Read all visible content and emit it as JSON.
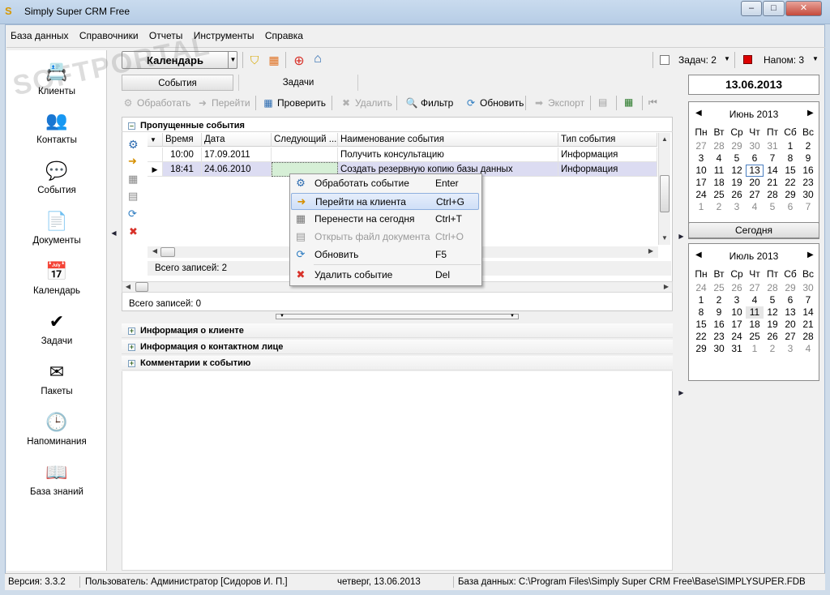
{
  "window": {
    "title": "Simply Super CRM Free",
    "app_icon_glyph": "S",
    "min": "–",
    "max": "□",
    "close": "✕"
  },
  "menu": [
    "База данных",
    "Справочники",
    "Отчеты",
    "Инструменты",
    "Справка"
  ],
  "toolbar": {
    "module_combo": "Календарь",
    "tasks_label": "Задач: 2",
    "reminders_label": "Напом: 3"
  },
  "watermark": "SOFTPORTAL",
  "nav": [
    {
      "label": "Клиенты",
      "icon": "clients-icon",
      "glyph": "📇"
    },
    {
      "label": "Контакты",
      "icon": "contacts-icon",
      "glyph": "👥"
    },
    {
      "label": "События",
      "icon": "events-icon",
      "glyph": "💬"
    },
    {
      "label": "Документы",
      "icon": "documents-icon",
      "glyph": "📄"
    },
    {
      "label": "Календарь",
      "icon": "calendar-icon",
      "glyph": "📅"
    },
    {
      "label": "Задачи",
      "icon": "tasks-icon",
      "glyph": "✔"
    },
    {
      "label": "Пакеты",
      "icon": "packages-icon",
      "glyph": "✉"
    },
    {
      "label": "Напоминания",
      "icon": "reminders-icon",
      "glyph": "🕒"
    },
    {
      "label": "База знаний",
      "icon": "knowledge-base-icon",
      "glyph": "📖"
    }
  ],
  "tabs": [
    "События",
    "Задачи"
  ],
  "actions": [
    {
      "label": "Обработать",
      "disabled": true,
      "glyph": "⚙"
    },
    {
      "label": "Перейти",
      "disabled": true,
      "glyph": "➜"
    },
    {
      "label": "Проверить",
      "disabled": false,
      "glyph": "▦"
    },
    {
      "label": "Удалить",
      "disabled": true,
      "glyph": "✖"
    },
    {
      "label": "Фильтр",
      "disabled": false,
      "glyph": "🔍"
    },
    {
      "label": "Обновить",
      "disabled": false,
      "glyph": "⟳"
    },
    {
      "label": "Экспорт",
      "disabled": true,
      "glyph": "➡"
    }
  ],
  "grid": {
    "group_title": "Пропущенные события",
    "columns": [
      "Время",
      "Дата",
      "Следующий ...",
      "Наименование события",
      "Тип события"
    ],
    "rows": [
      [
        "10:00",
        "17.09.2011",
        "",
        "Получить консультацию",
        "Информация"
      ],
      [
        "18:41",
        "24.06.2010",
        "",
        "Создать резервную копию базы данных",
        "Информация"
      ]
    ],
    "inner_total": "Всего записей: 2",
    "outer_total": "Всего записей: 0"
  },
  "context_menu": [
    {
      "label": "Обработать событие",
      "key": "Enter",
      "glyph": "⚙",
      "color": "#2a6ab0",
      "highlight": false,
      "disabled": false
    },
    {
      "label": "Перейти на клиента",
      "key": "Ctrl+G",
      "glyph": "➜",
      "color": "#d69000",
      "highlight": true,
      "disabled": false
    },
    {
      "label": "Перенести на сегодня",
      "key": "Ctrl+T",
      "glyph": "▦",
      "color": "#777777",
      "highlight": false,
      "disabled": false
    },
    {
      "label": "Открыть файл документа",
      "key": "Ctrl+O",
      "glyph": "▤",
      "color": "#9a9a9a",
      "highlight": false,
      "disabled": true
    },
    {
      "label": "Обновить",
      "key": "F5",
      "glyph": "⟳",
      "color": "#2a7ac0",
      "highlight": false,
      "disabled": false
    },
    {
      "label": "Удалить событие",
      "key": "Del",
      "glyph": "✖",
      "color": "#d8322a",
      "highlight": false,
      "disabled": false
    }
  ],
  "info_sections": [
    "Информация о клиенте",
    "Информация о контактном лице",
    "Комментарии к событию"
  ],
  "date_display": "13.06.2013",
  "today_button": "Сегодня",
  "calendars": [
    {
      "title": "Июнь 2013",
      "weekdays": [
        "Пн",
        "Вт",
        "Ср",
        "Чт",
        "Пт",
        "Сб",
        "Вс"
      ],
      "days": [
        [
          "27",
          "28",
          "29",
          "30",
          "31",
          "1",
          "2"
        ],
        [
          "3",
          "4",
          "5",
          "6",
          "7",
          "8",
          "9"
        ],
        [
          "10",
          "11",
          "12",
          "13",
          "14",
          "15",
          "16"
        ],
        [
          "17",
          "18",
          "19",
          "20",
          "21",
          "22",
          "23"
        ],
        [
          "24",
          "25",
          "26",
          "27",
          "28",
          "29",
          "30"
        ],
        [
          "1",
          "2",
          "3",
          "4",
          "5",
          "6",
          "7"
        ]
      ],
      "other": [
        [
          1,
          1,
          1,
          1,
          1,
          0,
          0
        ],
        [
          0,
          0,
          0,
          0,
          0,
          0,
          0
        ],
        [
          0,
          0,
          0,
          0,
          0,
          0,
          0
        ],
        [
          0,
          0,
          0,
          0,
          0,
          0,
          0
        ],
        [
          0,
          0,
          0,
          0,
          0,
          0,
          0
        ],
        [
          1,
          1,
          1,
          1,
          1,
          1,
          1
        ]
      ],
      "today": [
        2,
        3
      ]
    },
    {
      "title": "Июль 2013",
      "weekdays": [
        "Пн",
        "Вт",
        "Ср",
        "Чт",
        "Пт",
        "Сб",
        "Вс"
      ],
      "days": [
        [
          "24",
          "25",
          "26",
          "27",
          "28",
          "29",
          "30"
        ],
        [
          "1",
          "2",
          "3",
          "4",
          "5",
          "6",
          "7"
        ],
        [
          "8",
          "9",
          "10",
          "11",
          "12",
          "13",
          "14"
        ],
        [
          "15",
          "16",
          "17",
          "18",
          "19",
          "20",
          "21"
        ],
        [
          "22",
          "23",
          "24",
          "25",
          "26",
          "27",
          "28"
        ],
        [
          "29",
          "30",
          "31",
          "1",
          "2",
          "3",
          "4"
        ]
      ],
      "other": [
        [
          1,
          1,
          1,
          1,
          1,
          1,
          1
        ],
        [
          0,
          0,
          0,
          0,
          0,
          0,
          0
        ],
        [
          0,
          0,
          0,
          0,
          0,
          0,
          0
        ],
        [
          0,
          0,
          0,
          0,
          0,
          0,
          0
        ],
        [
          0,
          0,
          0,
          0,
          0,
          0,
          0
        ],
        [
          0,
          0,
          0,
          1,
          1,
          1,
          1
        ]
      ],
      "selected": [
        2,
        3
      ]
    }
  ],
  "status": {
    "version": "Версия: 3.3.2",
    "user": "Пользователь: Администратор [Сидоров И. П.]",
    "date": "четверг, 13.06.2013",
    "db": "База данных: C:\\Program Files\\Simply Super CRM Free\\Base\\SIMPLYSUPER.FDB"
  }
}
